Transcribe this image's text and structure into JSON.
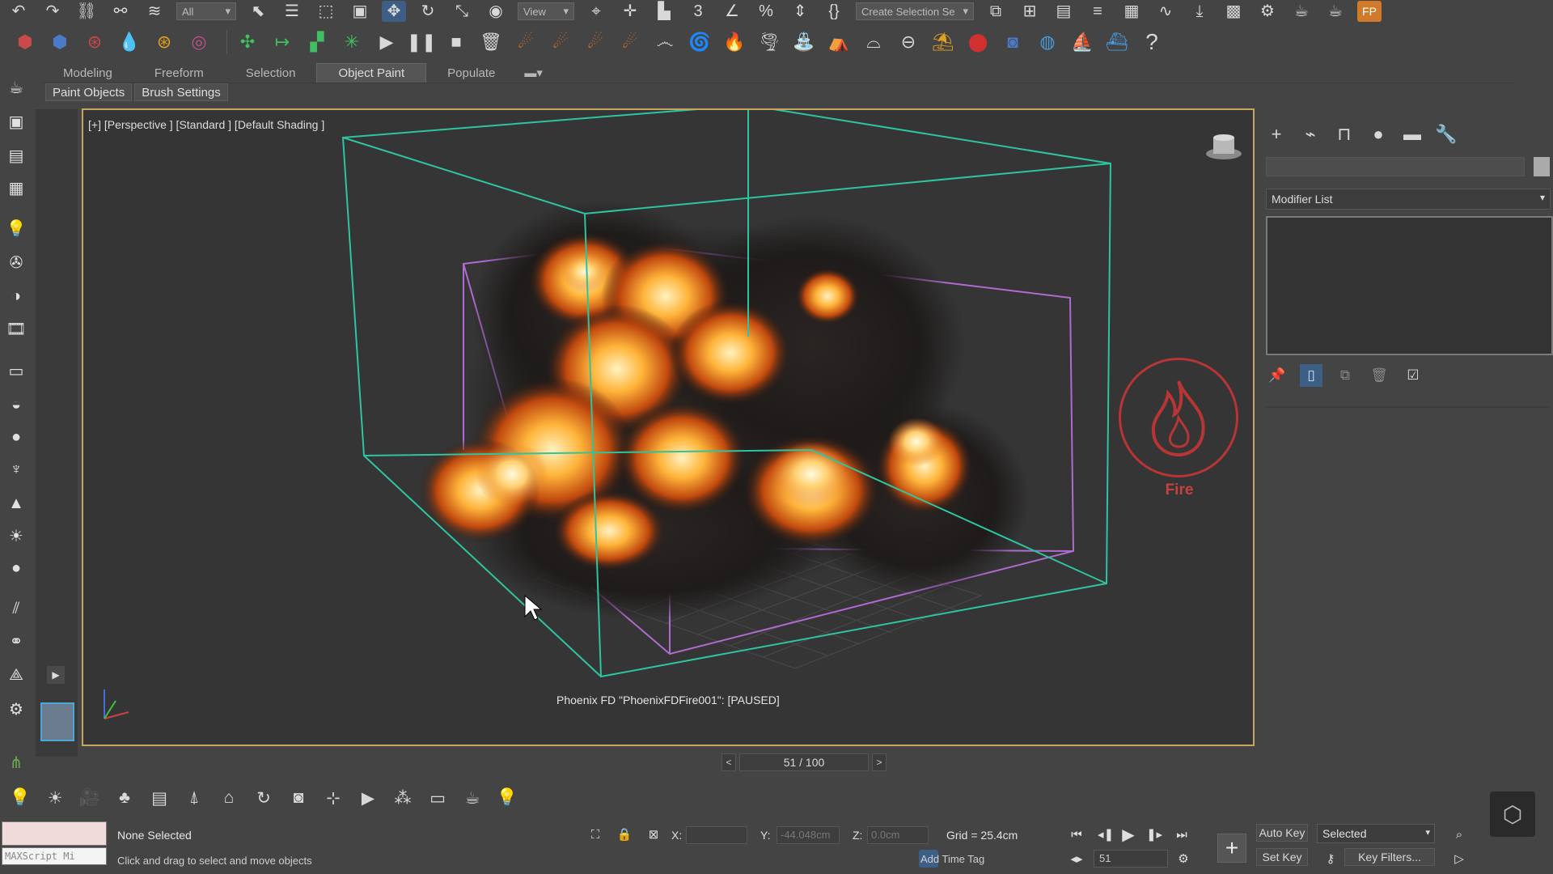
{
  "toolbar_top": {
    "filter_dropdown": "All",
    "view_dropdown": "View",
    "selection_set_dropdown": "Create Selection Se",
    "icons": [
      "undo-icon",
      "redo-icon",
      "link-icon",
      "unlink-icon",
      "bind-spacewarp-icon",
      "select-icon",
      "select-by-name-icon",
      "rect-region-icon",
      "window-crossing-icon",
      "move-icon",
      "rotate-icon",
      "scale-icon",
      "select-place-icon",
      "pivot-icon",
      "snap-icon",
      "angle-snap-icon",
      "percent-snap-icon",
      "spinner-snap-icon",
      "named-selection-icon",
      "mirror-icon",
      "align-icon",
      "layer-explorer-icon",
      "ribbon-toggle-icon",
      "curve-editor-icon",
      "schematic-icon",
      "material-editor-icon",
      "render-setup-icon",
      "render-frame-icon",
      "render-icon",
      "phoenix-fd-icon"
    ]
  },
  "toolbar_phoenix": {
    "icons": [
      "fire-smoke-sim-icon",
      "liquid-sim-icon",
      "fire-source-icon",
      "liquid-source-icon",
      "particle-flow-icon",
      "particle-shader-icon",
      "plane-force-icon",
      "foam-icon",
      "grid-icon",
      "start-sim-icon",
      "pause-sim-icon",
      "stop-sim-icon",
      "clear-cache-icon",
      "fire-preset-1-icon",
      "fire-preset-2-icon",
      "fire-preset-3-icon",
      "fire-preset-4-icon",
      "wind-icon",
      "vortex-icon",
      "candle-icon",
      "tornado-icon",
      "liquid-preset-1-icon",
      "liquid-preset-2-icon",
      "ocean-icon",
      "wave-icon",
      "splash-icon",
      "ink-icon",
      "explosion-icon",
      "drain-icon",
      "drop-icon",
      "ship-wake-icon",
      "pour-icon",
      "help-icon"
    ],
    "help_glyph": "?"
  },
  "ribbon": {
    "tabs": [
      {
        "label": "Modeling"
      },
      {
        "label": "Freeform"
      },
      {
        "label": "Selection"
      },
      {
        "label": "Object Paint"
      },
      {
        "label": "Populate"
      }
    ],
    "active_tab": "Object Paint",
    "subtabs": [
      {
        "label": "Paint Objects"
      },
      {
        "label": "Brush Settings"
      }
    ]
  },
  "viewport": {
    "label": "[+] [Perspective ] [Standard ] [Default Shading ]",
    "status": "Phoenix FD \"PhoenixFDFire001\": [PAUSED]",
    "fire_label": "Fire",
    "border_color": "#c7a760",
    "box_outer_color": "#2ec4a0",
    "box_inner_color": "#b06ad0"
  },
  "timeline": {
    "prev": "<",
    "next": ">",
    "frame_display": "51 / 100"
  },
  "command_panel": {
    "tabs": [
      "create-icon",
      "modify-icon",
      "hierarchy-icon",
      "motion-icon",
      "display-icon",
      "utilities-icon"
    ],
    "modifier_list": "Modifier List",
    "stack_tools": [
      "pin-stack-icon",
      "show-end-result-icon",
      "make-unique-icon",
      "remove-modifier-icon",
      "configure-sets-icon"
    ]
  },
  "bottom_toolbar": {
    "icons": [
      "light-icon",
      "sun-icon",
      "camera-icon",
      "tree-icon",
      "list-icon",
      "cone-icon",
      "door-icon",
      "rotate-obj-icon",
      "render-icon",
      "align-icon",
      "frame-icon",
      "particles-icon",
      "box-icon",
      "teapot-icon",
      "bulb-icon"
    ]
  },
  "status_bar": {
    "maxscript": "MAXScript Mi",
    "selection": "None Selected",
    "prompt": "Click and drag to select and move objects",
    "x_label": "X:",
    "x_value": "",
    "y_label": "Y:",
    "y_value": "-44.048cm",
    "z_label": "Z:",
    "z_value": "0.0cm",
    "grid": "Grid = 25.4cm",
    "add_time_tag": "Add Time Tag",
    "auto_key": "Auto Key",
    "set_key": "Set Key",
    "selected": "Selected",
    "key_filters": "Key Filters...",
    "current_frame": "51"
  }
}
